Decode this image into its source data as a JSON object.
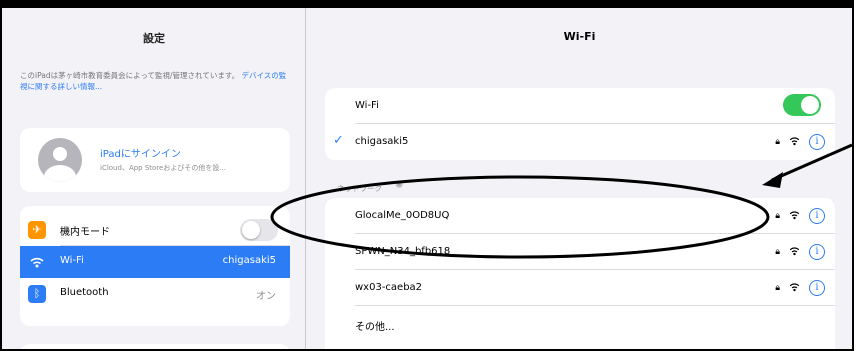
{
  "sidebar": {
    "title": "設定",
    "management_note": "このiPadは茅ヶ崎市教育委員会によって監視/管理されています。",
    "management_link": "デバイスの監視に関する詳しい情報...",
    "account": {
      "title": "iPadにサインイン",
      "subtitle": "iCloud、App Storeおよびその他を設..."
    },
    "items": [
      {
        "label": "機内モード",
        "icon": "airplane-icon",
        "icon_color": "#ff9500",
        "toggle": false
      },
      {
        "label": "Wi-Fi",
        "value": "chigasaki5",
        "icon": "wifi-icon",
        "icon_color": "#2c7cf6",
        "selected": true
      },
      {
        "label": "Bluetooth",
        "value": "オン",
        "icon": "bluetooth-icon",
        "icon_color": "#2c7cf6"
      }
    ]
  },
  "main": {
    "title": "Wi-Fi",
    "wifi_toggle_label": "Wi-Fi",
    "wifi_enabled": true,
    "connected_network": "chigasaki5",
    "networks_header": "ネットワーク",
    "networks": [
      {
        "name": "GlocalMe_0OD8UQ",
        "secured": true
      },
      {
        "name": "SPWN_N34_bfb618",
        "secured": true
      },
      {
        "name": "wx03-caeba2",
        "secured": true
      }
    ],
    "other_label": "その他..."
  },
  "colors": {
    "accent": "#2c7cf6",
    "toggle_on": "#34c759",
    "airplane": "#ff9500"
  }
}
